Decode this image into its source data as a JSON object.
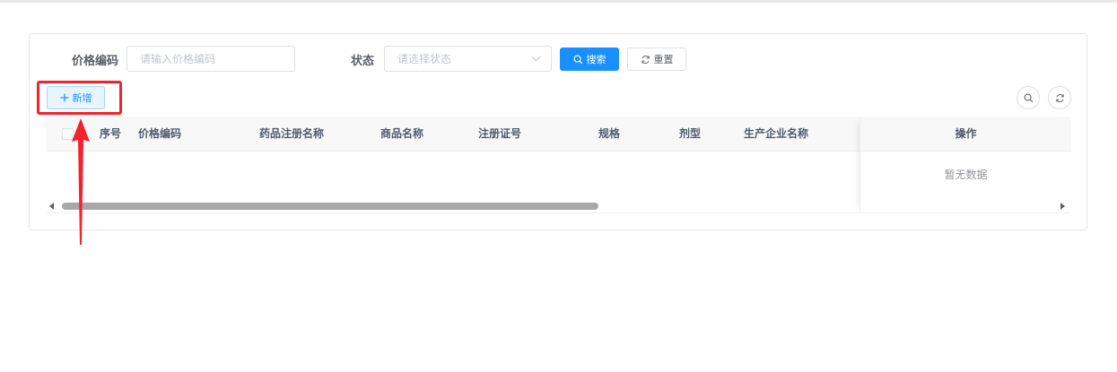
{
  "filters": {
    "price_code_label": "价格编码",
    "price_code_placeholder": "请输入价格编码",
    "status_label": "状态",
    "status_placeholder": "请选择状态",
    "search_label": "搜索",
    "reset_label": "重置"
  },
  "toolbar": {
    "add_label": "新增"
  },
  "table": {
    "columns": [
      "序号",
      "价格编码",
      "药品注册名称",
      "商品名称",
      "注册证号",
      "规格",
      "剂型",
      "生产企业名称"
    ],
    "action_column": "操作",
    "empty_text": "暂无数据"
  },
  "colors": {
    "primary": "#1890ff",
    "annotation": "#f5222d"
  },
  "icons": {
    "search": "search-icon",
    "reset": "refresh-icon",
    "add": "plus-icon",
    "toolbar_search": "search-icon",
    "toolbar_refresh": "refresh-icon"
  }
}
